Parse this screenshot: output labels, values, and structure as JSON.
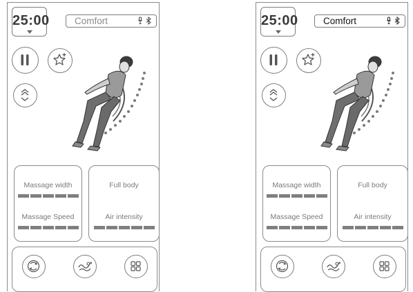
{
  "screens": [
    {
      "timer": "25:00",
      "mode": "Comfort",
      "cards": {
        "left": {
          "label_1": "Massage width",
          "level_1": 1.0,
          "label_2": "Massage Speed",
          "level_2": 1.0
        },
        "right": {
          "label_1": "Full body",
          "label_2": "Air intensity",
          "level_2": 1.0
        }
      }
    },
    {
      "timer": "25:00",
      "mode": "Comfort",
      "cards": {
        "left": {
          "label_1": "Massage width",
          "level_1": 1.0,
          "label_2": "Massage Speed",
          "level_2": 1.0
        },
        "right": {
          "label_1": "Full body",
          "label_2": "Air intensity",
          "level_2": 1.0
        }
      }
    }
  ],
  "icons": {
    "timer_dropdown": "chevron-down-icon",
    "mode_status": [
      "microphone-icon",
      "bluetooth-icon"
    ],
    "controls": [
      "pause-icon",
      "favorite-star-plus-icon",
      "recline-icon"
    ],
    "bottom": [
      "auto-program-icon",
      "wave-massage-icon",
      "grid-menu-icon"
    ]
  },
  "colors": {
    "outline": "#7d7d7d",
    "level_on": "#7f7f7f",
    "level_off": "#dddddd"
  }
}
